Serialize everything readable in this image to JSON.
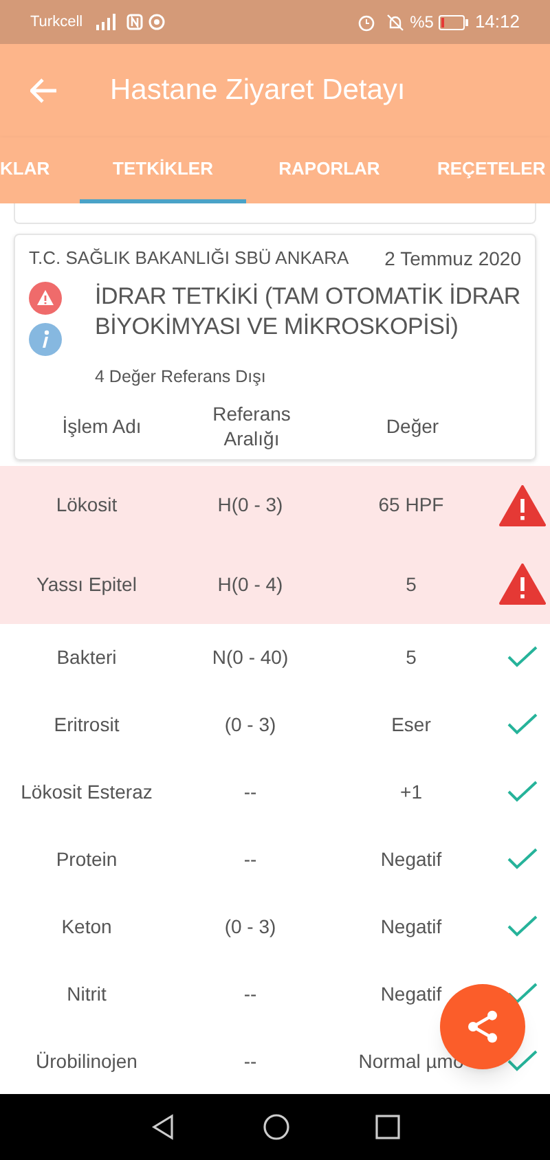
{
  "status_bar": {
    "carrier": "Turkcell",
    "battery": "%5",
    "time": "14:12"
  },
  "app_bar": {
    "title": "Hastane Ziyaret Detayı"
  },
  "tabs": [
    {
      "label": "KLAR",
      "selected": false
    },
    {
      "label": "TETKİKLER",
      "selected": true
    },
    {
      "label": "RAPORLAR",
      "selected": false
    },
    {
      "label": "REÇETELER",
      "selected": false
    }
  ],
  "card": {
    "hospital": "T.C. SAĞLIK BAKANLIĞI SBÜ ANKARA",
    "date": "2 Temmuz 2020",
    "title": "İDRAR TETKİKİ (TAM OTOMATİK İDRAR BİYOKİMYASI VE MİKROSKOPİSİ)",
    "subtitle": "4 Değer Referans Dışı",
    "columns": [
      "İşlem Adı",
      "Referans Aralığı",
      "Değer"
    ]
  },
  "rows": [
    {
      "name": "Lökosit",
      "range": "H(0 - 3)",
      "value": "65 HPF",
      "out_of_range": true
    },
    {
      "name": "Yassı Epitel",
      "range": "H(0 - 4)",
      "value": "5",
      "out_of_range": true
    },
    {
      "name": "Bakteri",
      "range": "N(0 - 40)",
      "value": "5",
      "out_of_range": false
    },
    {
      "name": "Eritrosit",
      "range": "(0 - 3)",
      "value": "Eser",
      "out_of_range": false
    },
    {
      "name": "Lökosit Esteraz",
      "range": "--",
      "value": "+1",
      "out_of_range": false
    },
    {
      "name": "Protein",
      "range": "--",
      "value": "Negatif",
      "out_of_range": false
    },
    {
      "name": "Keton",
      "range": "(0 - 3)",
      "value": "Negatif",
      "out_of_range": false
    },
    {
      "name": "Nitrit",
      "range": "--",
      "value": "Negatif",
      "out_of_range": false
    },
    {
      "name": "Ürobilinojen",
      "range": "--",
      "value": "Normal µmo",
      "out_of_range": false
    }
  ]
}
